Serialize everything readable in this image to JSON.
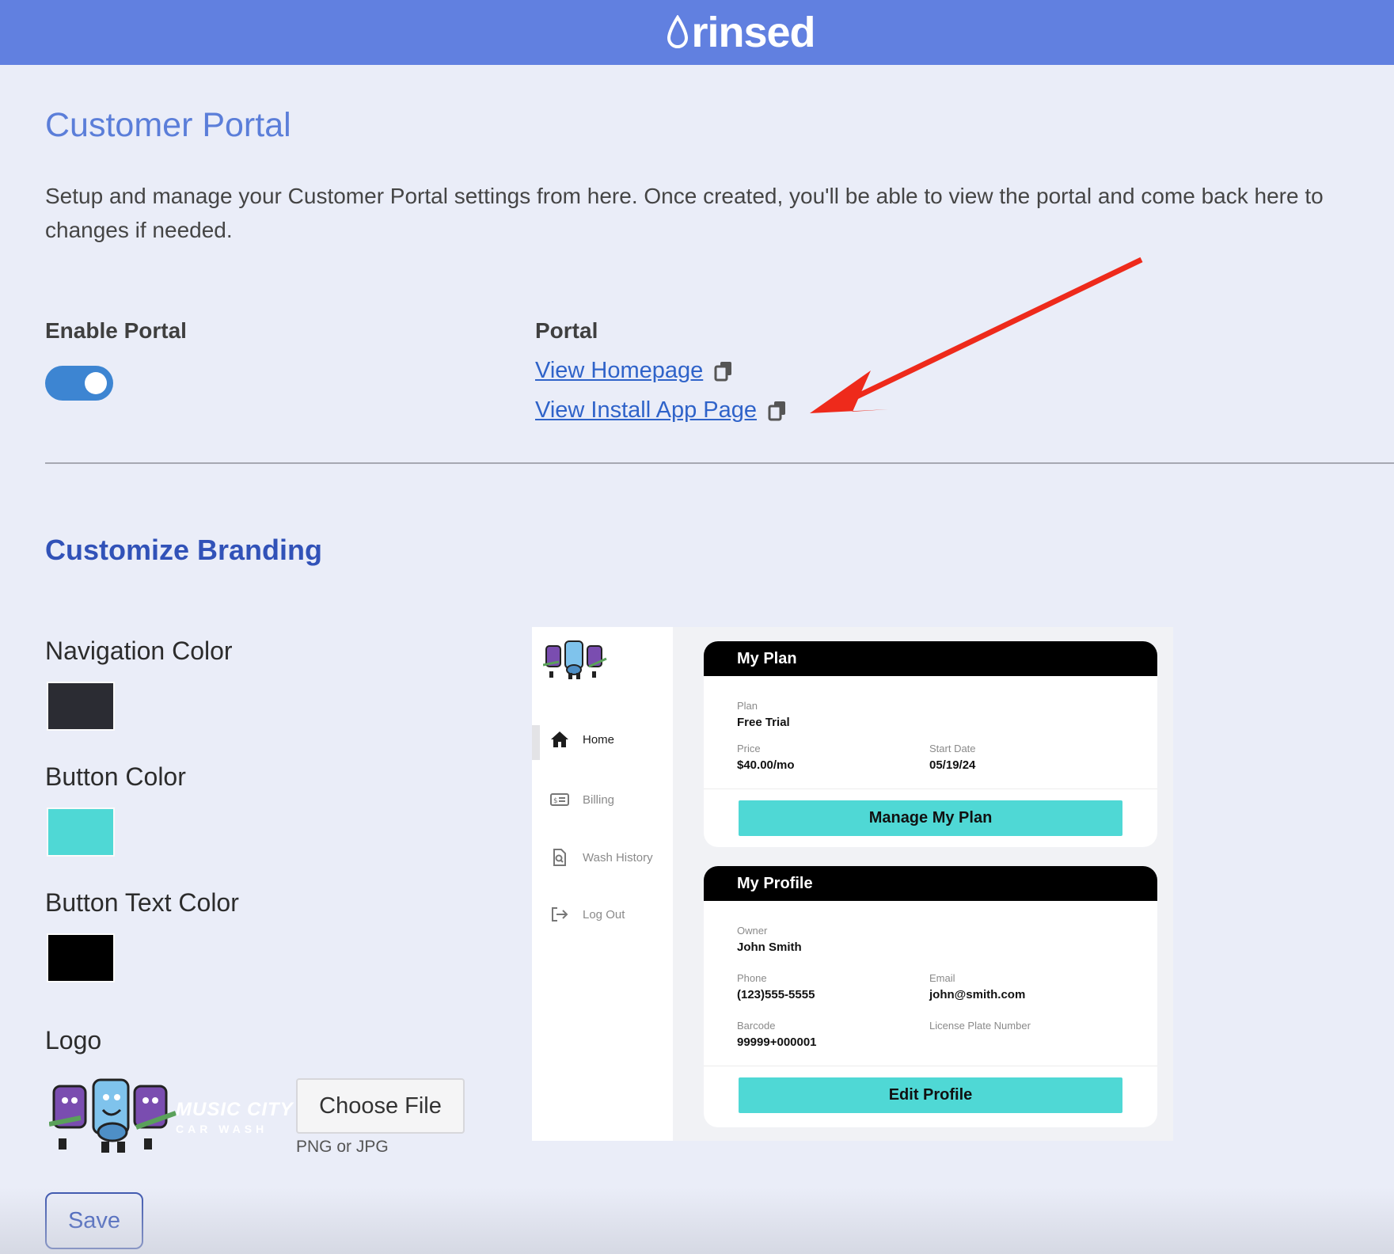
{
  "header": {
    "brand": "rinsed"
  },
  "page": {
    "title": "Customer Portal",
    "intro": "Setup and manage your Customer Portal settings from here. Once created, you'll be able to view the portal and come back here to changes if needed."
  },
  "enable_portal": {
    "label": "Enable Portal",
    "enabled": true
  },
  "portal": {
    "label": "Portal",
    "links": [
      "View Homepage",
      "View Install App Page"
    ]
  },
  "branding": {
    "title": "Customize Branding",
    "navigation_color": {
      "label": "Navigation Color",
      "value": "#2b2c33"
    },
    "button_color": {
      "label": "Button Color",
      "value": "#4fd8d5"
    },
    "button_text_color": {
      "label": "Button Text Color",
      "value": "#000000"
    },
    "logo": {
      "label": "Logo",
      "logo_text_1": "MUSIC CITY",
      "logo_text_2": "CAR WASH",
      "choose_file": "Choose File",
      "hint": "PNG or JPG"
    },
    "save": "Save"
  },
  "preview": {
    "nav": [
      "Home",
      "Billing",
      "Wash History",
      "Log Out"
    ],
    "plan_card": {
      "title": "My Plan",
      "plan_label": "Plan",
      "plan_value": "Free Trial",
      "price_label": "Price",
      "price_value": "$40.00/mo",
      "start_label": "Start Date",
      "start_value": "05/19/24",
      "button": "Manage My Plan"
    },
    "profile_card": {
      "title": "My Profile",
      "owner_label": "Owner",
      "owner_value": "John Smith",
      "phone_label": "Phone",
      "phone_value": "(123)555-5555",
      "email_label": "Email",
      "email_value": "john@smith.com",
      "barcode_label": "Barcode",
      "barcode_value": "99999+000001",
      "plate_label": "License Plate Number",
      "button": "Edit Profile"
    }
  },
  "colors": {
    "header": "#6180e0",
    "arrow": "#ee2a1b",
    "link": "#2f63c9"
  }
}
